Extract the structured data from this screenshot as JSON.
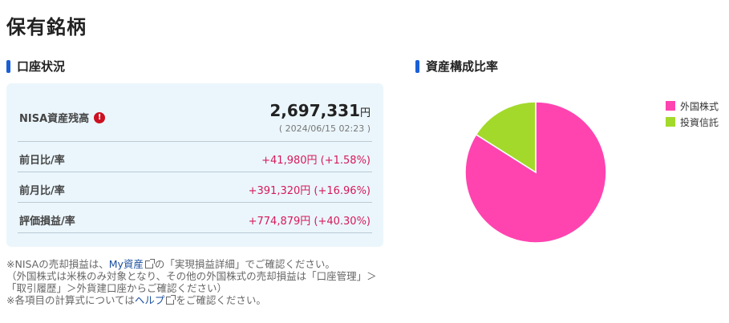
{
  "page": {
    "title": "保有銘柄"
  },
  "account_status": {
    "heading": "口座状況",
    "nisa": {
      "label": "NISA資産残高",
      "alert_icon": "exclamation-circle-icon",
      "amount": "2,697,331",
      "unit": "円",
      "timestamp": "( 2024/06/15 02:23 )"
    },
    "rows": [
      {
        "label": "前日比/率",
        "value": "+41,980円 (+1.58%)"
      },
      {
        "label": "前月比/率",
        "value": "+391,320円 (+16.96%)"
      },
      {
        "label": "評価損益/率",
        "value": "+774,879円 (+40.30%)"
      }
    ]
  },
  "composition": {
    "heading": "資産構成比率"
  },
  "chart_data": {
    "type": "pie",
    "categories": [
      "外国株式",
      "投資信託"
    ],
    "values": [
      84,
      16
    ],
    "colors": [
      "#ff44b0",
      "#a3d92b"
    ],
    "legend_position": "top-right"
  },
  "notes": {
    "line1_a": "※NISAの売却損益は、",
    "line1_link": "My資産",
    "line1_b": "の「実現損益詳細」でご確認ください。",
    "line2": "（外国株式は米株のみ対象となり、その他の外国株式の売却損益は「口座管理」＞「取引履歴」＞外貨建口座からご確認ください）",
    "line3_a": "※各項目の計算式については",
    "line3_link": "ヘルプ",
    "line3_b": "をご確認ください。"
  },
  "colors": {
    "accent": "#1a5fd6",
    "positive": "#d6195b",
    "card_bg": "#ebf6fc"
  }
}
